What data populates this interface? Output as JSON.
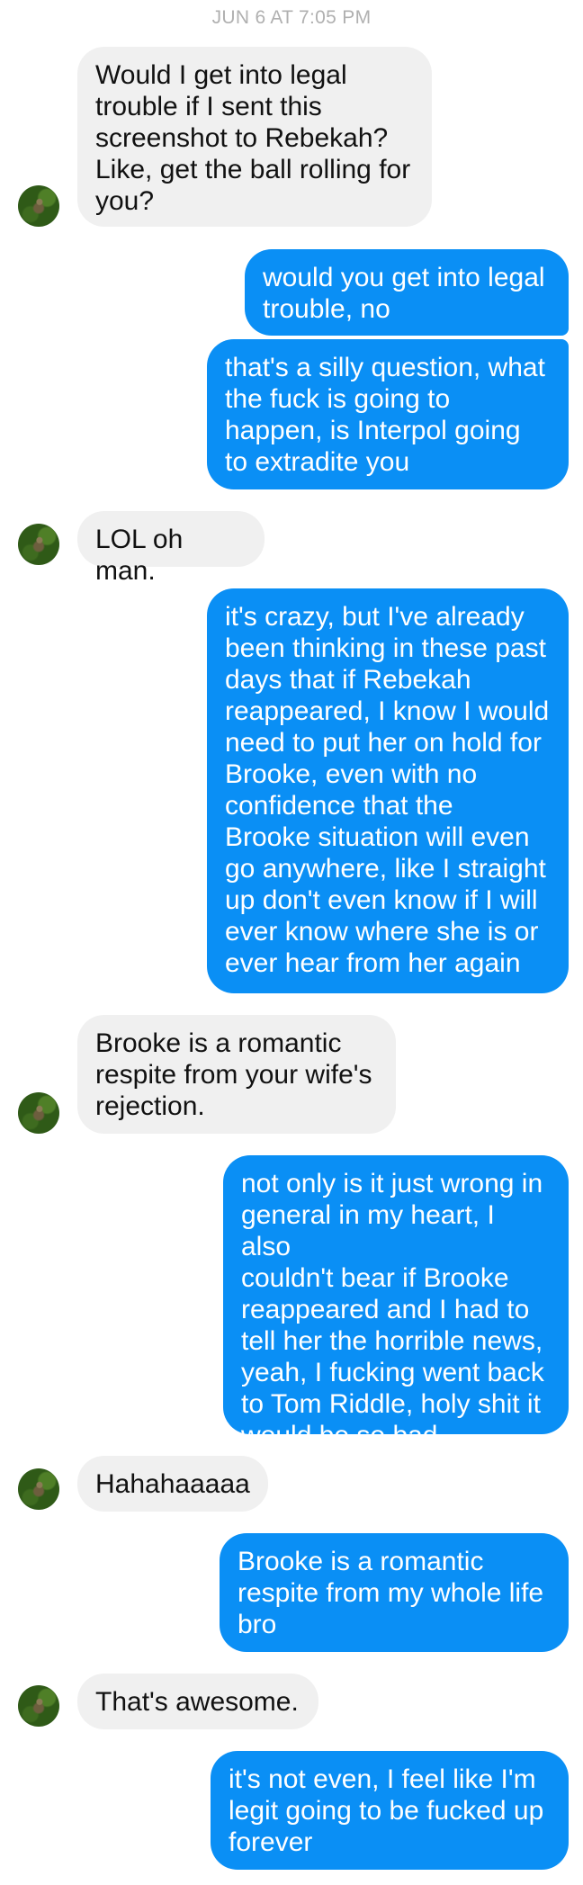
{
  "thread": {
    "timestamp": "JUN 6 AT 7:05 PM",
    "messages": [
      {
        "from": "them",
        "text": "Would I get into legal\ntrouble if I sent this\nscreenshot to Rebekah?\nLike, get the ball rolling for\nyou?"
      },
      {
        "from": "me",
        "text": "would you get into legal\ntrouble, no"
      },
      {
        "from": "me",
        "text": "that's a silly question, what\nthe fuck is going to\nhappen, is Interpol going\nto extradite you"
      },
      {
        "from": "them",
        "text": "LOL oh man."
      },
      {
        "from": "me",
        "text": "it's crazy, but I've already\nbeen thinking in these past\ndays that if Rebekah\nreappeared, I know I would\nneed to put her on hold for\nBrooke, even with no\nconfidence that the\nBrooke situation will even\ngo anywhere, like I straight\nup don't even know if I will\never know where she is or\never hear from her again"
      },
      {
        "from": "them",
        "text": "Brooke is a romantic\nrespite from your wife's\nrejection."
      },
      {
        "from": "me",
        "text": "not only is it just wrong in\ngeneral in my heart, I also\ncouldn't bear if Brooke\nreappeared and I had to\ntell her the horrible news,\nyeah, I fucking went back\nto Tom Riddle, holy shit it\nwould be so bad"
      },
      {
        "from": "them",
        "text": "Hahahaaaaa"
      },
      {
        "from": "me",
        "text": "Brooke is a romantic\nrespite from my whole life\nbro"
      },
      {
        "from": "them",
        "text": "That's awesome."
      },
      {
        "from": "me",
        "text": "it's not even, I feel like I'm\nlegit going to be fucked up\nforever"
      }
    ]
  },
  "colors": {
    "outgoing_bubble": "#0a8ff5",
    "incoming_bubble": "#f0f0f0",
    "timestamp_text": "#b0b0b0"
  },
  "icons": {
    "contact_avatar": "contact-avatar-icon"
  }
}
